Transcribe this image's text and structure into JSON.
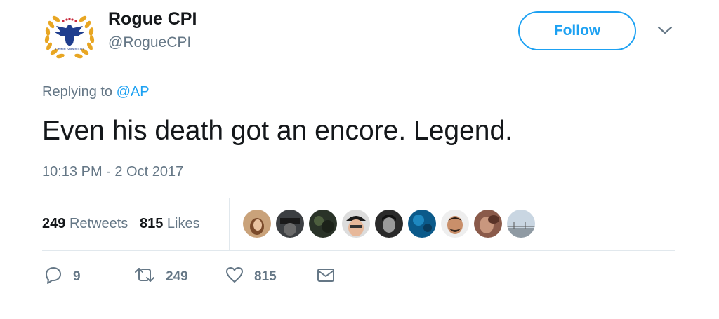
{
  "header": {
    "display_name": "Rogue CPI",
    "handle": "@RogueCPI",
    "follow_label": "Follow",
    "avatar_text": "United States CPI"
  },
  "reply": {
    "prefix": "Replying to",
    "mention": "@AP"
  },
  "tweet": {
    "text": "Even his death got an encore. Legend.",
    "timestamp": "10:13 PM - 2 Oct 2017"
  },
  "stats": {
    "retweets_count": "249",
    "retweets_label": "Retweets",
    "likes_count": "815",
    "likes_label": "Likes"
  },
  "likers": [
    {
      "name": "liker-1"
    },
    {
      "name": "liker-2"
    },
    {
      "name": "liker-3"
    },
    {
      "name": "liker-4"
    },
    {
      "name": "liker-5"
    },
    {
      "name": "liker-6"
    },
    {
      "name": "liker-7"
    },
    {
      "name": "liker-8"
    },
    {
      "name": "liker-9"
    }
  ],
  "actions": {
    "reply_count": "9",
    "retweet_count": "249",
    "like_count": "815"
  },
  "icons": {
    "reply": "reply-icon",
    "retweet": "retweet-icon",
    "like": "heart-icon",
    "message": "envelope-icon",
    "caret": "chevron-down-icon"
  },
  "colors": {
    "accent": "#1da1f2",
    "text": "#14171a",
    "muted": "#657786",
    "divider": "#e1e8ed",
    "laurel": "#e8a623",
    "eagle": "#1f3e8e"
  }
}
